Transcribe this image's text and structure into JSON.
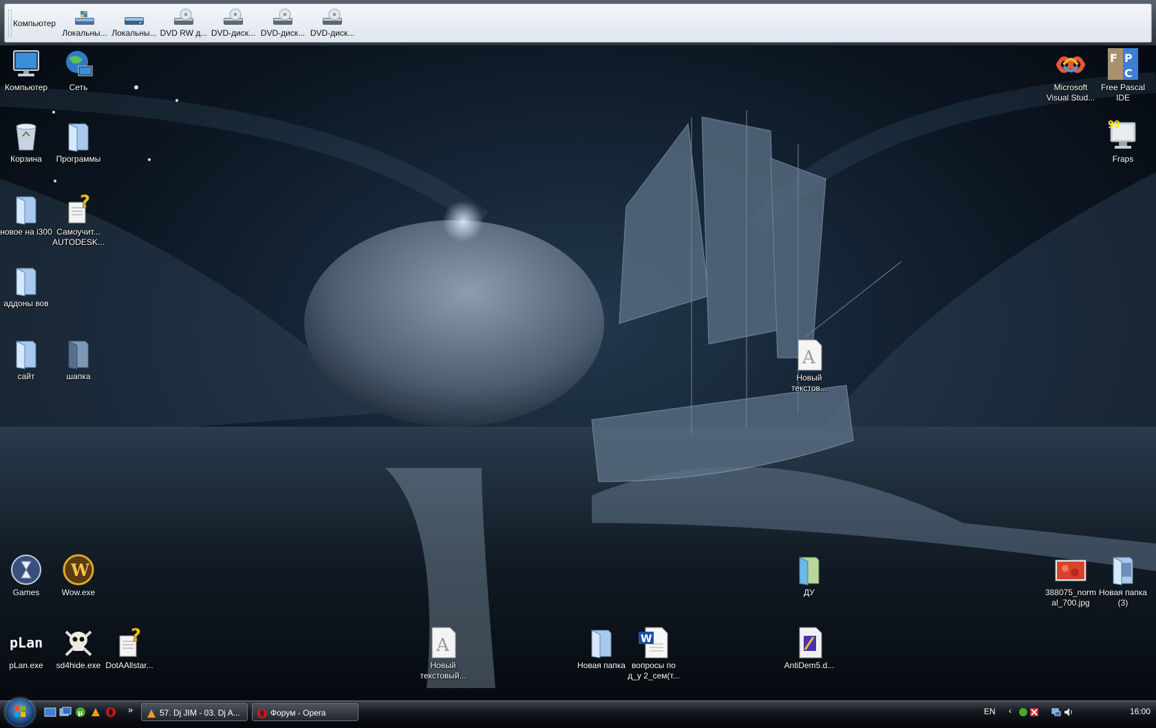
{
  "toolbar": {
    "title": "Компьютер",
    "drives": [
      {
        "label": "Локальны...",
        "icon": "windows-drive-icon"
      },
      {
        "label": "Локальны...",
        "icon": "hard-drive-icon"
      },
      {
        "label": "DVD RW д...",
        "icon": "dvd-drive-icon"
      },
      {
        "label": "DVD-диск...",
        "icon": "dvd-drive-icon"
      },
      {
        "label": "DVD-диск...",
        "icon": "dvd-drive-icon"
      },
      {
        "label": "DVD-диск...",
        "icon": "dvd-drive-icon"
      }
    ]
  },
  "desktop": {
    "computer": "Компьютер",
    "network": "Сеть",
    "recycle_bin": "Корзина",
    "programs": "Программы",
    "new_i300": "новое на i300",
    "tutorial": "Самоучит... AUTODESK...",
    "addons": "аддоны вов",
    "site": "сайт",
    "hat": "шапка",
    "games": "Games",
    "wow": "Wow.exe",
    "plan": "pLan.exe",
    "plan_logo": "pLan",
    "sd4hide": "sd4hide.exe",
    "dota": "DotAAllstar...",
    "new_text_bottom": "Новый текстовый...",
    "new_folder": "Новая папка",
    "questions": "вопросы по д_у 2_сем(т...",
    "antidem": "AntiDem5.d...",
    "du": "ДУ",
    "new_text_mid": "Новый текстов...",
    "msvs": "Microsoft Visual Stud...",
    "fpc": "Free Pascal IDE",
    "fraps": "Fraps",
    "fraps_counter": "99",
    "jpg": "388075_normal_700.jpg",
    "new_folder3": "Новая папка (3)"
  },
  "taskbar": {
    "tasks": [
      {
        "label": "57. Dj JIM - 03. Dj A...",
        "icon": "winamp-icon"
      },
      {
        "label": "Форум - Opera",
        "icon": "opera-icon"
      }
    ],
    "quicklaunch_more": "»",
    "language": "EN",
    "clock": "16:00"
  },
  "colors": {
    "sky": "#0a1420",
    "moon": "#5f7186",
    "sea": "#1c2a38",
    "accent": "#7fa7d0"
  }
}
